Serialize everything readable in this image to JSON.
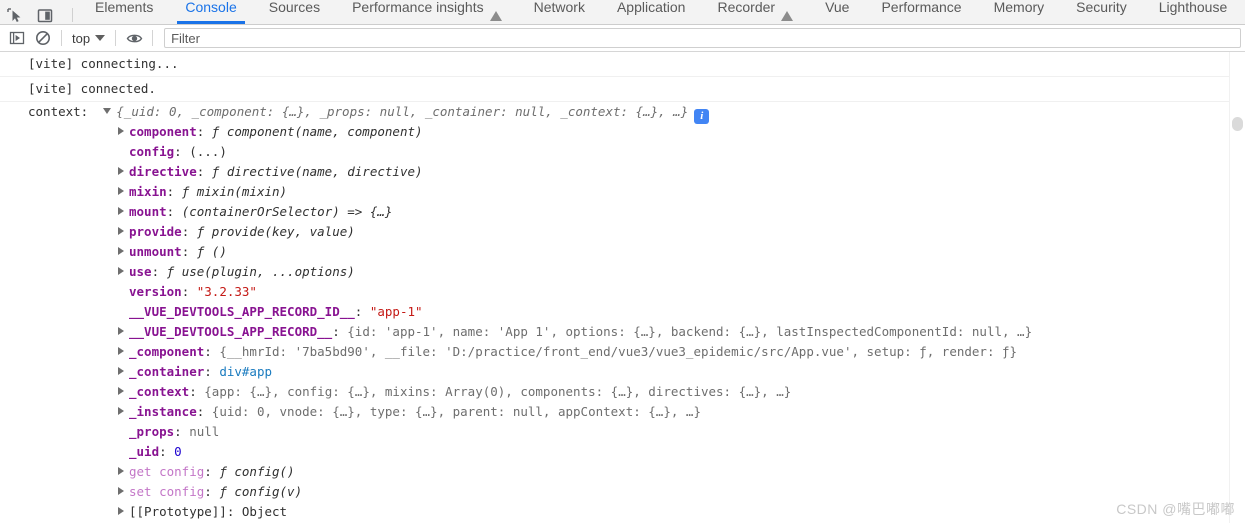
{
  "devtools": {
    "toolbar_icons": [
      {
        "name": "inspect-element-icon",
        "title": "Inspect element"
      },
      {
        "name": "device-toolbar-icon",
        "title": "Toggle device toolbar"
      }
    ],
    "tabs": [
      {
        "label": "Elements",
        "active": false,
        "warning": false
      },
      {
        "label": "Console",
        "active": true,
        "warning": false
      },
      {
        "label": "Sources",
        "active": false,
        "warning": false
      },
      {
        "label": "Performance insights",
        "active": false,
        "warning": true
      },
      {
        "label": "Network",
        "active": false,
        "warning": false
      },
      {
        "label": "Application",
        "active": false,
        "warning": false
      },
      {
        "label": "Recorder",
        "active": false,
        "warning": true
      },
      {
        "label": "Vue",
        "active": false,
        "warning": false
      },
      {
        "label": "Performance",
        "active": false,
        "warning": false
      },
      {
        "label": "Memory",
        "active": false,
        "warning": false
      },
      {
        "label": "Security",
        "active": false,
        "warning": false
      },
      {
        "label": "Lighthouse",
        "active": false,
        "warning": false
      }
    ],
    "accent_color": "#1a73e8"
  },
  "console_toolbar": {
    "execute_label": "Execute / Console sidebar",
    "clear_label": "Clear console",
    "context_selector": "top",
    "eye_label": "Create live expression",
    "filter_placeholder": "Filter",
    "filter_value": ""
  },
  "console": {
    "messages": [
      {
        "type": "log",
        "text": "[vite] connecting..."
      },
      {
        "type": "log",
        "text": "[vite] connected."
      }
    ],
    "object_log": {
      "label": "context:",
      "preview": "{_uid: 0, _component: {…}, _props: null, _container: null, _context: {…}, …}",
      "info_icon": "i",
      "properties": [
        {
          "expandable": true,
          "key": "component",
          "key_style": "prop",
          "value": "ƒ component(name, component)",
          "value_style": "fn"
        },
        {
          "expandable": false,
          "key": "config",
          "key_style": "prop",
          "value": "(...)",
          "value_style": "plain"
        },
        {
          "expandable": true,
          "key": "directive",
          "key_style": "prop",
          "value": "ƒ directive(name, directive)",
          "value_style": "fn"
        },
        {
          "expandable": true,
          "key": "mixin",
          "key_style": "prop",
          "value": "ƒ mixin(mixin)",
          "value_style": "fn"
        },
        {
          "expandable": true,
          "key": "mount",
          "key_style": "prop",
          "value": "(containerOrSelector) => {…}",
          "value_style": "fn"
        },
        {
          "expandable": true,
          "key": "provide",
          "key_style": "prop",
          "value": "ƒ provide(key, value)",
          "value_style": "fn"
        },
        {
          "expandable": true,
          "key": "unmount",
          "key_style": "prop",
          "value": "ƒ ()",
          "value_style": "fn"
        },
        {
          "expandable": true,
          "key": "use",
          "key_style": "prop",
          "value": "ƒ use(plugin, ...options)",
          "value_style": "fn"
        },
        {
          "expandable": false,
          "key": "version",
          "key_style": "prop",
          "value": "\"3.2.33\"",
          "value_style": "str"
        },
        {
          "expandable": false,
          "key": "__VUE_DEVTOOLS_APP_RECORD_ID__",
          "key_style": "prop",
          "value": "\"app-1\"",
          "value_style": "str"
        },
        {
          "expandable": true,
          "key": "__VUE_DEVTOOLS_APP_RECORD__",
          "key_style": "prop",
          "value": "{id: 'app-1', name: 'App 1', options: {…}, backend: {…}, lastInspectedComponentId: null, …}",
          "value_style": "preview"
        },
        {
          "expandable": true,
          "key": "_component",
          "key_style": "prop",
          "value": "{__hmrId: '7ba5bd90', __file: 'D:/practice/front_end/vue3/vue3_epidemic/src/App.vue', setup: ƒ, render: ƒ}",
          "value_style": "preview"
        },
        {
          "expandable": true,
          "key": "_container",
          "key_style": "prop",
          "value": "div#app",
          "value_style": "node"
        },
        {
          "expandable": true,
          "key": "_context",
          "key_style": "prop",
          "value": "{app: {…}, config: {…}, mixins: Array(0), components: {…}, directives: {…}, …}",
          "value_style": "preview"
        },
        {
          "expandable": true,
          "key": "_instance",
          "key_style": "prop",
          "value": "{uid: 0, vnode: {…}, type: {…}, parent: null, appContext: {…}, …}",
          "value_style": "preview"
        },
        {
          "expandable": false,
          "key": "_props",
          "key_style": "prop",
          "value": "null",
          "value_style": "null"
        },
        {
          "expandable": false,
          "key": "_uid",
          "key_style": "prop",
          "value": "0",
          "value_style": "num"
        },
        {
          "expandable": true,
          "key": "get config",
          "key_style": "access",
          "value": "ƒ config()",
          "value_style": "fn"
        },
        {
          "expandable": true,
          "key": "set config",
          "key_style": "access",
          "value": "ƒ config(v)",
          "value_style": "fn"
        },
        {
          "expandable": true,
          "key": "[[Prototype]]",
          "key_style": "proto",
          "value": "Object",
          "value_style": "plain"
        }
      ]
    }
  },
  "watermark": "CSDN @嘴巴嘟嘟"
}
